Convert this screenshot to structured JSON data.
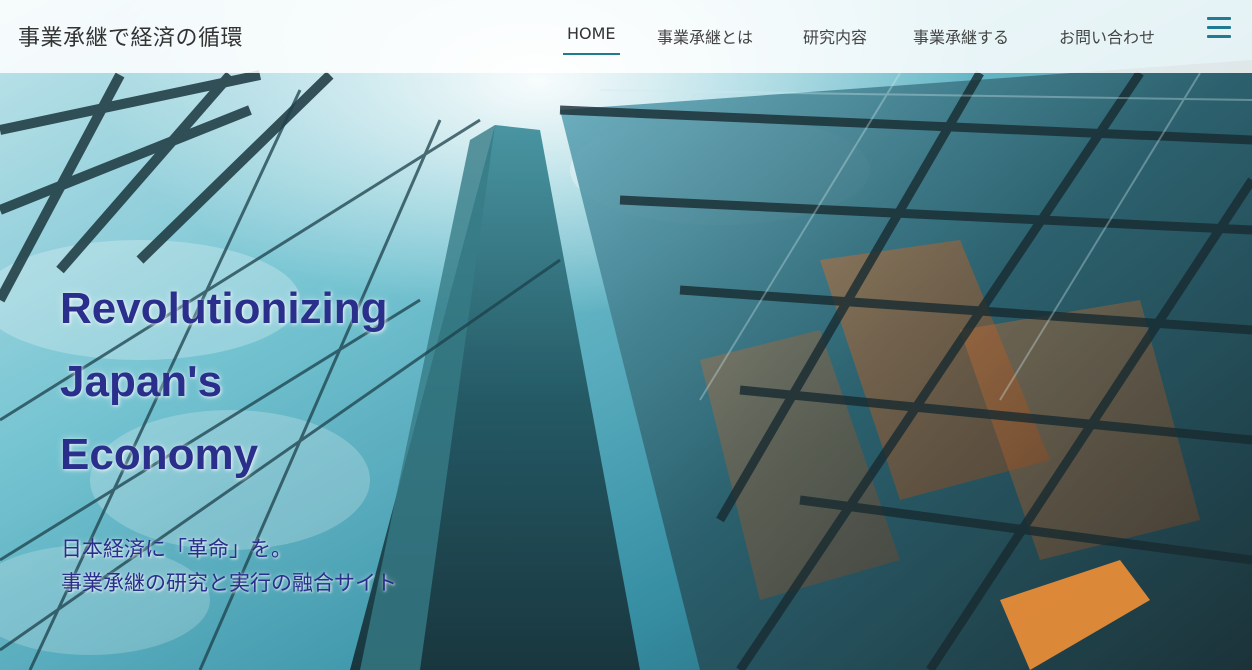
{
  "header": {
    "site_title": "事業承継で経済の循環",
    "nav": [
      {
        "label": "HOME",
        "active": true
      },
      {
        "label": "事業承継とは",
        "active": false
      },
      {
        "label": "研究内容",
        "active": false
      },
      {
        "label": "事業承継する",
        "active": false
      },
      {
        "label": "お問い合わせ",
        "active": false
      }
    ],
    "menu_icon": "hamburger-icon"
  },
  "hero": {
    "headline": [
      "Revolutionizing",
      "Japan's",
      "Economy"
    ],
    "tagline": [
      "日本経済に「革命」を。",
      "事業承継の研究と実行の融合サイト"
    ]
  },
  "colors": {
    "accent": "#1f7a94",
    "headline": "#2a2f8c",
    "nav_text": "#444444"
  }
}
